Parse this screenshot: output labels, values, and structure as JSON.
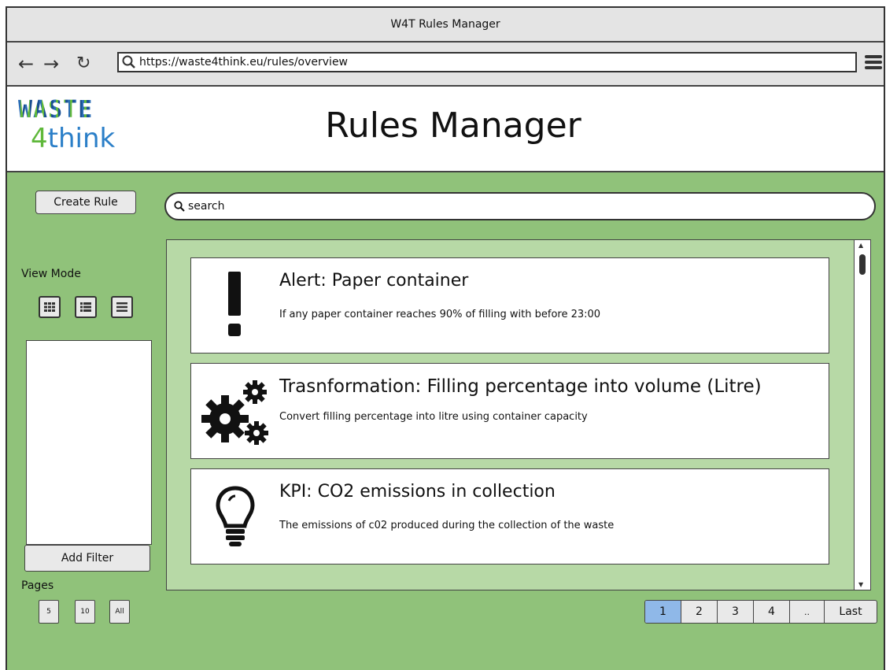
{
  "window": {
    "title": "W4T Rules Manager"
  },
  "browser": {
    "url": "https://waste4think.eu/rules/overview"
  },
  "logo": {
    "top": "WASTE",
    "four": "4",
    "think": "think"
  },
  "header": {
    "title": "Rules Manager"
  },
  "sidebar": {
    "create_rule": "Create Rule",
    "view_mode_label": "View Mode",
    "add_filter": "Add Filter",
    "pages_label": "Pages",
    "page_sizes": [
      "5",
      "10",
      "All"
    ]
  },
  "search": {
    "value": "search"
  },
  "rules": [
    {
      "icon": "exclamation-icon",
      "title": "Alert: Paper container",
      "description": "If any paper container  reaches 90% of filling with before 23:00"
    },
    {
      "icon": "gears-icon",
      "title": "Trasnformation: Filling percentage into volume (Litre)",
      "description": "Convert filling percentage into litre using container capacity"
    },
    {
      "icon": "lightbulb-icon",
      "title": "KPI: CO2 emissions in collection",
      "description": "The emissions of c02 produced during the collection of the waste"
    }
  ],
  "pagination": {
    "pages": [
      "1",
      "2",
      "3",
      "4",
      "..",
      "Last"
    ],
    "active": "1"
  },
  "colors": {
    "background": "#90c27a",
    "content_panel": "#b7d9a6",
    "active_page": "#8fb8e8"
  }
}
